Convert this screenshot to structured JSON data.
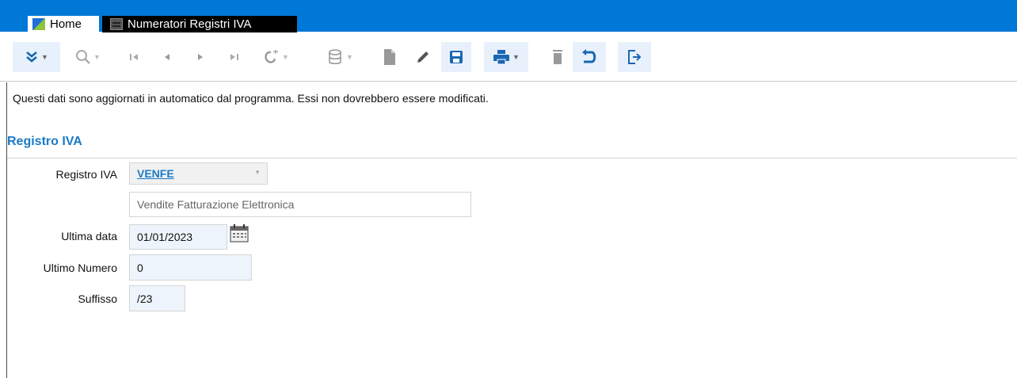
{
  "tabs": [
    {
      "label": "Home"
    },
    {
      "label": "Numeratori Registri IVA"
    }
  ],
  "toolbar": {
    "buttons": [
      {
        "name": "expand",
        "icon": "double-chevron-down-icon",
        "enabled": true
      },
      {
        "name": "search",
        "icon": "search-icon",
        "enabled": false
      },
      {
        "name": "first",
        "icon": "first-record-icon",
        "enabled": false
      },
      {
        "name": "previous",
        "icon": "previous-record-icon",
        "enabled": false
      },
      {
        "name": "next",
        "icon": "next-record-icon",
        "enabled": false
      },
      {
        "name": "last",
        "icon": "last-record-icon",
        "enabled": false
      },
      {
        "name": "link",
        "icon": "link-icon",
        "enabled": false
      },
      {
        "name": "database",
        "icon": "database-icon",
        "enabled": false
      },
      {
        "name": "new",
        "icon": "new-document-icon",
        "enabled": false
      },
      {
        "name": "edit",
        "icon": "pencil-icon",
        "enabled": false
      },
      {
        "name": "save",
        "icon": "save-icon",
        "enabled": true
      },
      {
        "name": "print",
        "icon": "print-icon",
        "enabled": true
      },
      {
        "name": "delete",
        "icon": "trash-icon",
        "enabled": false
      },
      {
        "name": "undo",
        "icon": "undo-icon",
        "enabled": true
      },
      {
        "name": "exit",
        "icon": "exit-icon",
        "enabled": true
      }
    ]
  },
  "info_text": "Questi dati sono aggiornati in automatico dal programma. Essi non dovrebbero essere modificati.",
  "section_title": "Registro IVA",
  "form": {
    "registro": {
      "label": "Registro IVA",
      "value": "VENFE",
      "description": "Vendite Fatturazione Elettronica"
    },
    "ultima_data": {
      "label": "Ultima data",
      "value": "01/01/2023"
    },
    "ultimo_numero": {
      "label": "Ultimo Numero",
      "value": "0"
    },
    "suffisso": {
      "label": "Suffisso",
      "value": "/23"
    }
  },
  "colors": {
    "accent": "#0078d7",
    "section_title": "#1a7ac7",
    "field_background": "#edf4fc"
  }
}
